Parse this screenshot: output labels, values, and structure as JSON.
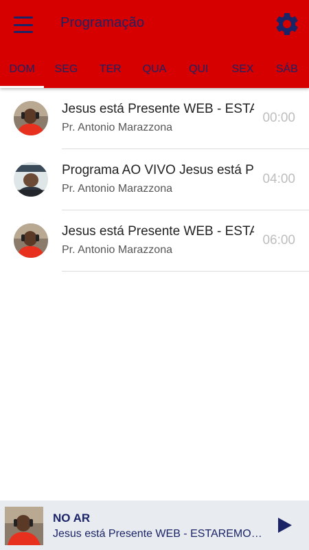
{
  "header": {
    "title": "Programação",
    "menu_icon": "hamburger-menu-icon",
    "settings_icon": "gear-icon",
    "background_color": "#d60000",
    "accent_color": "#1a2466"
  },
  "tabs": [
    {
      "label": "DOM",
      "active": true
    },
    {
      "label": "SEG",
      "active": false
    },
    {
      "label": "TER",
      "active": false
    },
    {
      "label": "QUA",
      "active": false
    },
    {
      "label": "QUI",
      "active": false
    },
    {
      "label": "SEX",
      "active": false
    },
    {
      "label": "SÁB",
      "active": false
    }
  ],
  "schedule": [
    {
      "title": "Jesus está Presente WEB - ESTAREMOS",
      "host": "Pr. Antonio Marazzona",
      "time": "00:00"
    },
    {
      "title": "Programa AO VIVO Jesus está Presente",
      "host": "Pr. Antonio Marazzona",
      "time": "04:00"
    },
    {
      "title": "Jesus está Presente WEB - ESTAREMOS",
      "host": "Pr. Antonio Marazzona",
      "time": "06:00"
    }
  ],
  "player": {
    "label": "NO AR",
    "title": "Jesus está Presente WEB - ESTAREMOS AO VIVO",
    "play_icon": "play-icon"
  }
}
